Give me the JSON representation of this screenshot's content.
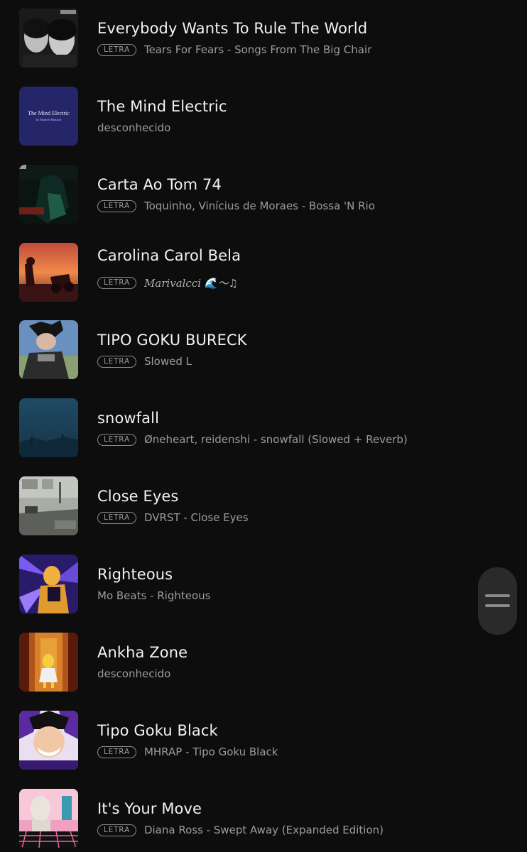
{
  "badge_label": "LETRA",
  "tracks": [
    {
      "title": "Everybody Wants To Rule The World",
      "subtitle": "Tears For Fears - Songs From The Big Chair",
      "has_lyrics": true,
      "art": "black-and-white-portrait"
    },
    {
      "title": "The Mind Electric",
      "subtitle": "desconhecido",
      "has_lyrics": false,
      "art": "blue-cover-text",
      "art_text_1": "The Mind Electric",
      "art_text_2": "by Miracle Musical"
    },
    {
      "title": "Carta Ao Tom 74",
      "subtitle": "Toquinho, Vinícius de Moraes - Bossa 'N Rio",
      "has_lyrics": true,
      "art": "dark-green-anime"
    },
    {
      "title": "Carolina Carol Bela",
      "subtitle": "Marivalcci 🌊〜♫",
      "has_lyrics": true,
      "art": "sunset-anime"
    },
    {
      "title": "TIPO GOKU BURECK",
      "subtitle": "Slowed L",
      "has_lyrics": true,
      "art": "goku-black-anime"
    },
    {
      "title": "snowfall",
      "subtitle": "Øneheart, reidenshi - snowfall (Slowed + Reverb)",
      "has_lyrics": true,
      "art": "misty-blue-landscape"
    },
    {
      "title": "Close Eyes",
      "subtitle": "DVRST - Close Eyes",
      "has_lyrics": true,
      "art": "street-photo"
    },
    {
      "title": "Righteous",
      "subtitle": "Mo Beats - Righteous",
      "has_lyrics": false,
      "art": "purple-anime"
    },
    {
      "title": "Ankha Zone",
      "subtitle": "desconhecido",
      "has_lyrics": false,
      "art": "egyptian-room"
    },
    {
      "title": "Tipo Goku Black",
      "subtitle": "MHRAP - Tipo Goku Black",
      "has_lyrics": true,
      "art": "goku-black-purple"
    },
    {
      "title": "It's Your Move",
      "subtitle": "Diana Ross - Swept Away (Expanded Edition)",
      "has_lyrics": true,
      "art": "vaporwave-statue"
    }
  ],
  "scroll_handle": {
    "icon": "drag-handle-icon"
  }
}
